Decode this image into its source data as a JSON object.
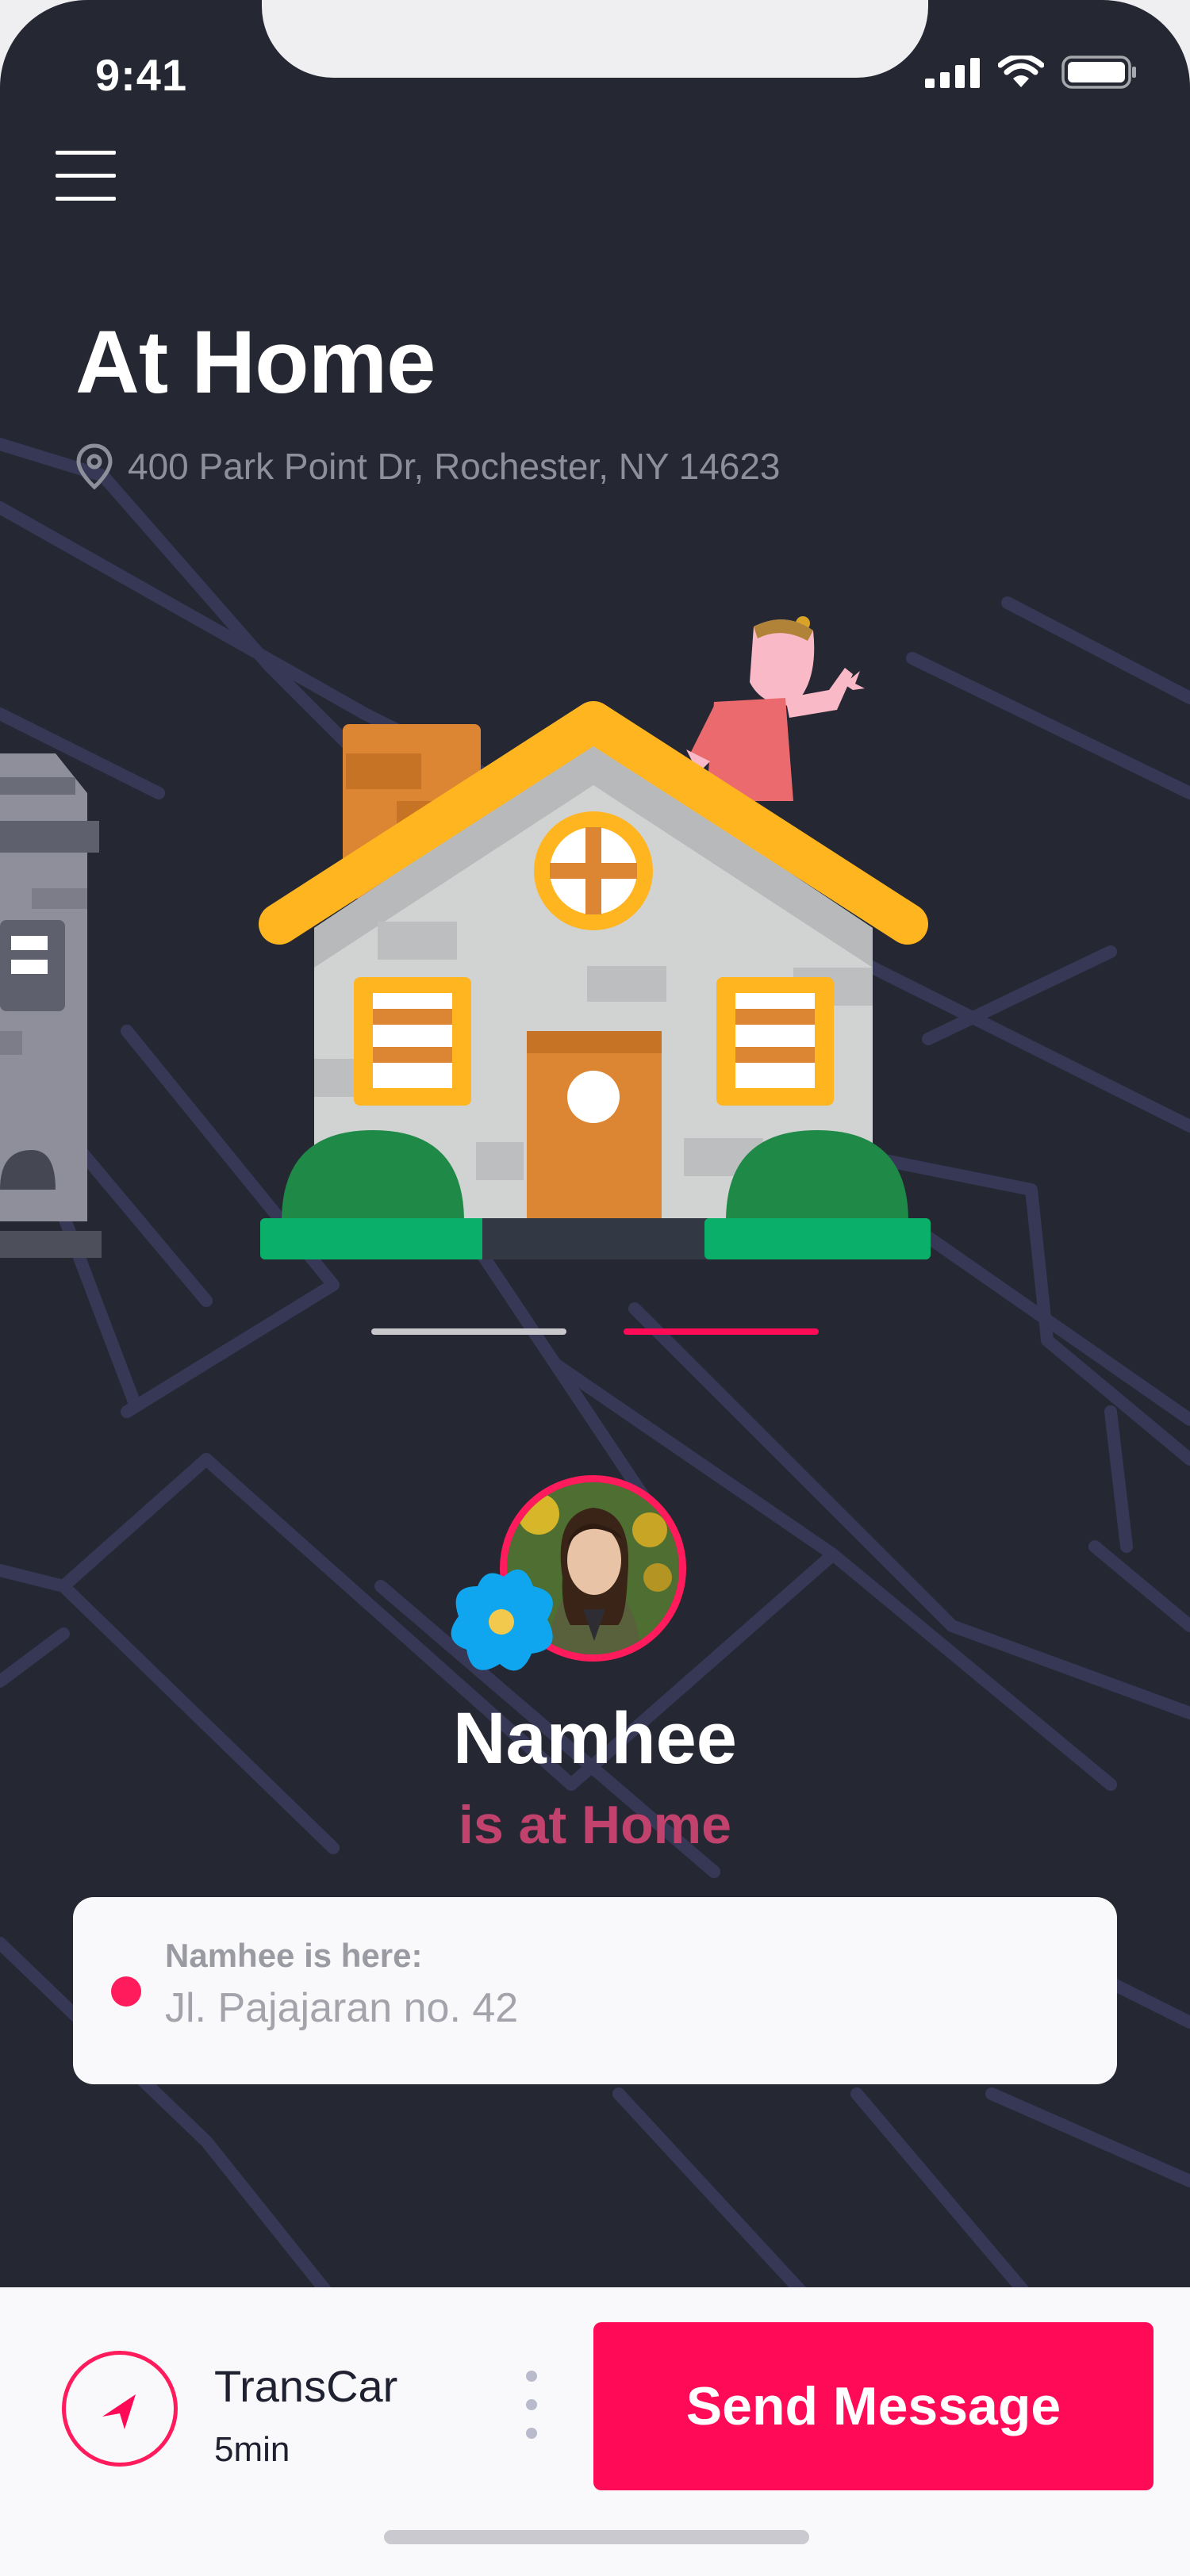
{
  "status_bar": {
    "time": "9:41",
    "icons": [
      "signal-icon",
      "wifi-icon",
      "battery-icon"
    ]
  },
  "header": {
    "menu_icon": "hamburger-menu-icon",
    "title": "At Home",
    "address": "400 Park Point Dr, Rochester, NY 14623",
    "address_icon": "location-pin-icon"
  },
  "carousel": {
    "pages": 2,
    "active_page": 2
  },
  "person": {
    "name": "Namhee",
    "status": "is at Home"
  },
  "location_card": {
    "label": "Namhee is here:",
    "value": "Jl. Pajajaran no. 42"
  },
  "bottom_bar": {
    "car_name": "TransCar",
    "car_eta": "5min",
    "send_label": "Send Message"
  },
  "colors": {
    "background": "#252733",
    "accent": "#ff0a57",
    "status_text": "#c2426e",
    "map_lines": "#383a5a"
  }
}
